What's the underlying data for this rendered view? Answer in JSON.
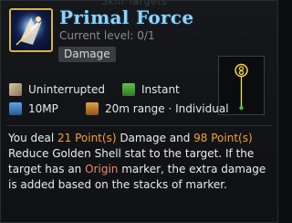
{
  "skill": {
    "ghost_text": "Skill Targets",
    "title": "Primal Force",
    "level_label": "Current level:",
    "level_value": "0/1",
    "type_tag": "Damage",
    "icon": "primal-force-skill-icon"
  },
  "attributes": {
    "row1": [
      {
        "icon": "uninterrupted-icon",
        "label": "Uninterrupted"
      },
      {
        "icon": "instant-icon",
        "label": "Instant"
      }
    ],
    "row2": [
      {
        "icon": "mp-cost-icon",
        "label": "10MP"
      },
      {
        "icon": "range-icon",
        "label": "20m range · Individual"
      }
    ]
  },
  "description": {
    "part1": "You deal ",
    "value1": "21 Point(s)",
    "part2": " Damage and ",
    "value2": "98 Point(s)",
    "part3": " Reduce Golden Shell stat to the target. If the target has an ",
    "keyword": "Origin",
    "part4": " marker, the extra damage is added based on the stacks of marker."
  },
  "colors": {
    "title": "#8fd3f4",
    "highlight_value": "#f2a23a",
    "highlight_keyword": "#ee8a6e",
    "icon_border": "#d9b24a"
  }
}
